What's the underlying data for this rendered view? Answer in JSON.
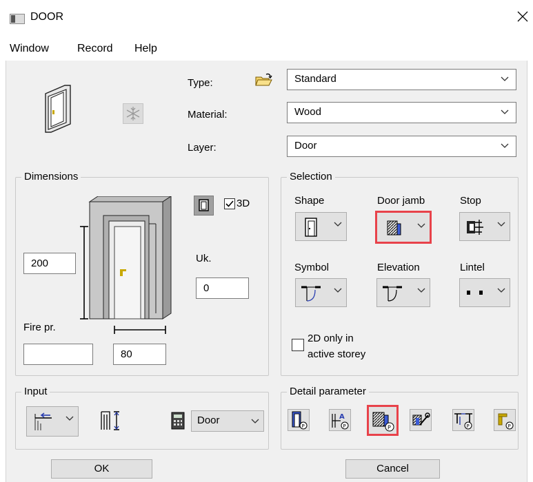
{
  "window": {
    "title": "DOOR"
  },
  "menu": [
    "Window",
    "Record",
    "Help"
  ],
  "top": {
    "type_label": "Type:",
    "type_value": "Standard",
    "material_label": "Material:",
    "material_value": "Wood",
    "layer_label": "Layer:",
    "layer_value": "Door"
  },
  "dimensions": {
    "title": "Dimensions",
    "height": "200",
    "width": "80",
    "uk_label": "Uk.",
    "uk_value": "0",
    "fire_label": "Fire pr.",
    "fire_value": "",
    "threed_label": "3D",
    "threed_checked": true
  },
  "selection": {
    "title": "Selection",
    "shape_label": "Shape",
    "jamb_label": "Door jamb",
    "stop_label": "Stop",
    "symbol_label": "Symbol",
    "elevation_label": "Elevation",
    "lintel_label": "Lintel",
    "checkbox_label_1": "2D only in",
    "checkbox_label_2": "active storey",
    "checkbox_checked": false
  },
  "input": {
    "title": "Input",
    "combo_value": "Door"
  },
  "detail": {
    "title": "Detail parameter"
  },
  "buttons": {
    "ok": "OK",
    "cancel": "Cancel"
  },
  "colors": {
    "highlight": "#e8424a",
    "panel": "#f0f0f0",
    "door_fill": "#d9d9d9",
    "handle": "#c8a800"
  }
}
